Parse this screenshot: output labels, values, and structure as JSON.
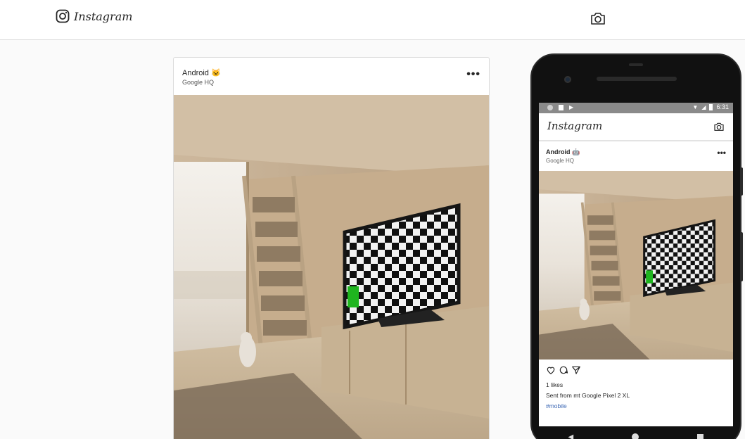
{
  "header": {
    "brand": "Instagram",
    "logo_icon": "instagram-logo-icon",
    "camera_icon": "camera-icon"
  },
  "post": {
    "username": "Android 🐱",
    "location": "Google HQ",
    "more": "•••",
    "image_alt_icon": "room-photo"
  },
  "phone": {
    "status_time": "6:31",
    "app_brand": "Instagram",
    "post_username": "Android 🤖",
    "post_location": "Google HQ",
    "more": "•••",
    "likes": "1 likes",
    "caption": "Sent from mt Google Pixel 2 XL",
    "hashtag": "#mobile",
    "actions": [
      "heart-icon",
      "comment-icon",
      "share-icon"
    ],
    "nav": [
      "back-icon",
      "home-icon",
      "recents-icon"
    ]
  },
  "colors": {
    "accent_link": "#3f6ab5",
    "border": "#dbdbdb",
    "background": "#fafafa",
    "tv_highlight": "#1fb51f"
  }
}
